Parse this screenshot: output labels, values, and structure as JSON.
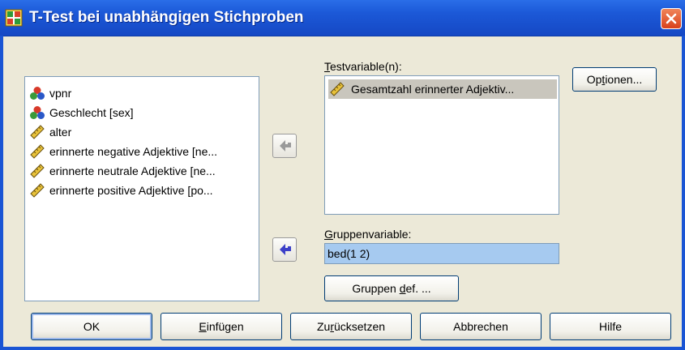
{
  "window": {
    "title": "T-Test bei unabhängigen Stichproben",
    "icon": "ttest-app-icon",
    "close_icon": "close-icon"
  },
  "source_list": {
    "items": [
      {
        "label": "vpnr",
        "icon": "nominal-variable-icon"
      },
      {
        "label": "Geschlecht [sex]",
        "icon": "nominal-variable-icon"
      },
      {
        "label": "alter",
        "icon": "scale-variable-icon"
      },
      {
        "label": "erinnerte negative Adjektive [ne...",
        "icon": "scale-variable-icon"
      },
      {
        "label": "erinnerte neutrale Adjektive [ne...",
        "icon": "scale-variable-icon"
      },
      {
        "label": "erinnerte positive Adjektive [po...",
        "icon": "scale-variable-icon"
      }
    ]
  },
  "test_variables": {
    "label_mnemonic": "T",
    "label_rest": "estvariable(n):",
    "items": [
      {
        "label": "Gesamtzahl erinnerter Adjektiv...",
        "icon": "scale-variable-icon"
      }
    ]
  },
  "grouping": {
    "label_mnemonic": "G",
    "label_rest": "ruppenvariable:",
    "value": "bed(1 2)"
  },
  "buttons": {
    "options": {
      "pre": "Op",
      "mnemonic": "t",
      "post": "ionen..."
    },
    "define_groups": {
      "pre": "Gruppen ",
      "mnemonic": "d",
      "post": "ef. ..."
    },
    "ok": {
      "pre": "OK",
      "mnemonic": "",
      "post": ""
    },
    "paste": {
      "pre": "",
      "mnemonic": "E",
      "post": "infügen"
    },
    "reset": {
      "pre": "Zu",
      "mnemonic": "r",
      "post": "ücksetzen"
    },
    "cancel": {
      "pre": "Abbrechen",
      "mnemonic": "",
      "post": ""
    },
    "help": {
      "pre": "Hilfe",
      "mnemonic": "",
      "post": ""
    }
  },
  "arrows": {
    "move_to_test": "arrow-right-icon",
    "move_to_group": "arrow-right-icon"
  },
  "colors": {
    "titlebar": "#1c59d8",
    "dialog_bg": "#ece9d8",
    "selection": "#a6caf0",
    "arrow_active": "#3c40c8",
    "arrow_inactive": "#9a9a9a"
  }
}
